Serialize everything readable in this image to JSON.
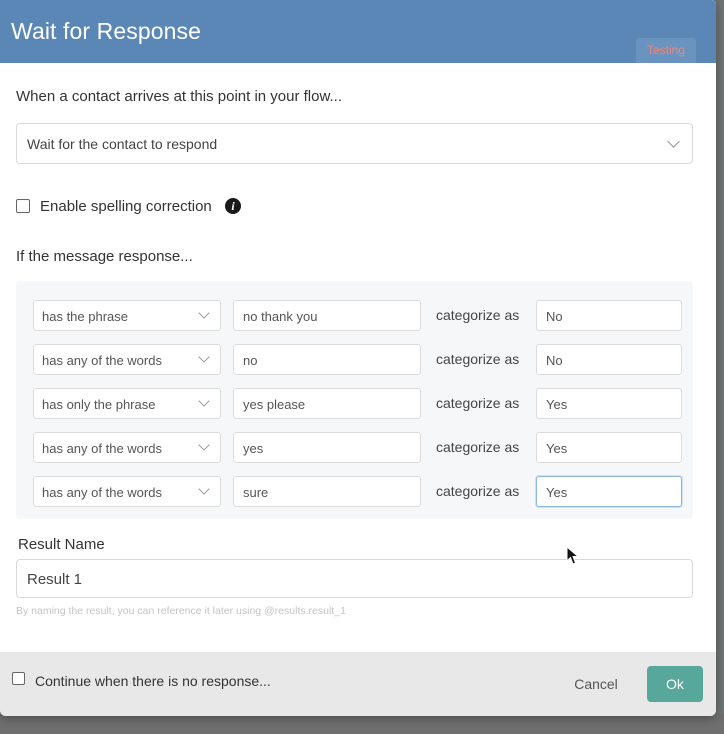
{
  "dialog": {
    "title": "Wait for Response",
    "badge": "Testing"
  },
  "arrival": {
    "label": "When a contact arrives at this point in your flow...",
    "selected": "Wait for the contact to respond"
  },
  "spelling": {
    "label": "Enable spelling correction",
    "checked": false,
    "info_icon": "i"
  },
  "rules": {
    "label": "If the message response...",
    "category_label": "categorize as",
    "rows": [
      {
        "operator": "has the phrase",
        "argument": "no thank you",
        "category": "No"
      },
      {
        "operator": "has any of the words",
        "argument": "no",
        "category": "No"
      },
      {
        "operator": "has only the phrase",
        "argument": "yes please",
        "category": "Yes"
      },
      {
        "operator": "has any of the words",
        "argument": "yes",
        "category": "Yes"
      },
      {
        "operator": "has any of the words",
        "argument": "sure",
        "category": "Yes"
      }
    ]
  },
  "result": {
    "label": "Result Name",
    "value": "Result 1",
    "hint": "By naming the result, you can reference it later using @results.result_1"
  },
  "footer": {
    "continue_label": "Continue when there is no response...",
    "cancel_label": "Cancel",
    "ok_label": "Ok"
  },
  "colors": {
    "header": "#5b87b6",
    "ok_button": "#57a79a",
    "testing_text": "#e88a7a"
  },
  "icons": {
    "info": "info-icon",
    "dropdown": "chevron-down-icon",
    "cursor": "mouse-cursor-icon"
  }
}
